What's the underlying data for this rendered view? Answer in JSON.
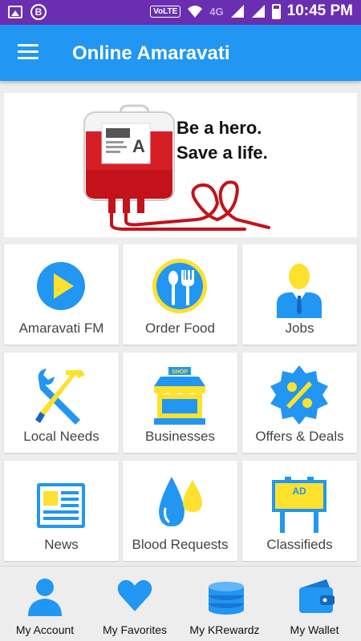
{
  "status_bar": {
    "volte": "VoLTE",
    "network": "4G",
    "time": "10:45 PM",
    "left_icons": [
      "gallery-icon",
      "b-circle-icon"
    ]
  },
  "app_bar": {
    "title": "Online Amaravati",
    "menu_icon": "hamburger-icon"
  },
  "banner": {
    "line1": "Be a hero.",
    "line2": "Save a life.",
    "bag_label": "A"
  },
  "grid": [
    {
      "label": "Amaravati FM",
      "icon": "play-icon"
    },
    {
      "label": "Order Food",
      "icon": "plate-cutlery-icon"
    },
    {
      "label": "Jobs",
      "icon": "businessman-icon"
    },
    {
      "label": "Local Needs",
      "icon": "tools-icon"
    },
    {
      "label": "Businesses",
      "icon": "shop-icon"
    },
    {
      "label": "Offers & Deals",
      "icon": "percent-badge-icon"
    },
    {
      "label": "News",
      "icon": "newspaper-icon"
    },
    {
      "label": "Blood Requests",
      "icon": "drops-icon"
    },
    {
      "label": "Classifieds",
      "icon": "billboard-icon"
    }
  ],
  "shop_sign": "SHOP",
  "billboard_text": "AD",
  "bottom_nav": [
    {
      "label": "My Account",
      "icon": "user-icon"
    },
    {
      "label": "My Favorites",
      "icon": "heart-icon"
    },
    {
      "label": "My KRewardz",
      "icon": "coins-icon"
    },
    {
      "label": "My Wallet",
      "icon": "wallet-icon"
    }
  ],
  "colors": {
    "status_bar": "#6a2fb0",
    "app_bar": "#2196f3",
    "icon_blue": "#2196f3",
    "icon_yellow": "#fde12d",
    "blood_red": "#c4121b"
  }
}
